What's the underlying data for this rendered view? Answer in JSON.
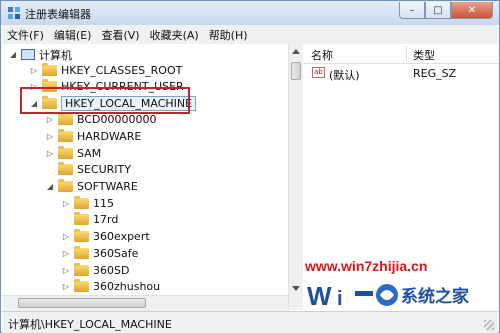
{
  "window": {
    "title": "注册表编辑器",
    "buttons": {
      "minimize": "–",
      "maximize": "□",
      "close": "✕"
    }
  },
  "menu": [
    "文件(F)",
    "编辑(E)",
    "查看(V)",
    "收藏夹(A)",
    "帮助(H)"
  ],
  "tree": {
    "root": "计算机",
    "hives": [
      "HKEY_CLASSES_ROOT",
      "HKEY_CURRENT_USER",
      "HKEY_LOCAL_MACHINE"
    ],
    "hklm_children": [
      "BCD00000000",
      "HARDWARE",
      "SAM",
      "SECURITY",
      "SOFTWARE"
    ],
    "software_children": [
      "115",
      "17rd",
      "360expert",
      "360Safe",
      "360SD",
      "360zhushou"
    ]
  },
  "list": {
    "headers": {
      "name": "名称",
      "type": "类型"
    },
    "rows": [
      {
        "name": "(默认)",
        "type": "REG_SZ"
      }
    ]
  },
  "status": "计算机\\HKEY_LOCAL_MACHINE",
  "watermark": {
    "url": "www.win7zhijia.cn",
    "brand": "系统之家"
  },
  "colors": {
    "highlight_box": "#c0272d",
    "watermark_red": "#d41818"
  }
}
